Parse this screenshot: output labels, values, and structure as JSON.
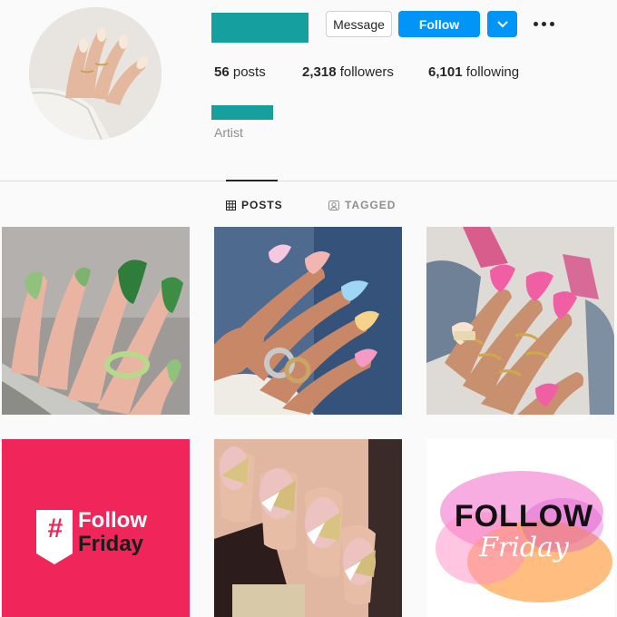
{
  "profile": {
    "bio_category": "Artist",
    "stats": {
      "posts_count": "56",
      "posts_label": "posts",
      "followers_count": "2,318",
      "followers_label": "followers",
      "following_count": "6,101",
      "following_label": "following"
    }
  },
  "actions": {
    "message_label": "Message",
    "follow_label": "Follow",
    "dropdown_icon": "chevron-down-icon",
    "more_icon": "ellipsis-icon"
  },
  "tabs": [
    {
      "label": "POSTS",
      "icon": "grid-icon",
      "active": true
    },
    {
      "label": "TAGGED",
      "icon": "tag-user-icon",
      "active": false
    }
  ],
  "posts": [
    {
      "kind": "photo",
      "subject": "green-french-tip-nails"
    },
    {
      "kind": "photo",
      "subject": "pastel-tip-nails"
    },
    {
      "kind": "photo",
      "subject": "pink-marble-nails"
    },
    {
      "kind": "graphic",
      "line1": "Follow",
      "line2": "Friday",
      "hash": "#",
      "bg_color": "#f0265a"
    },
    {
      "kind": "photo",
      "subject": "pink-gold-geometric-nails"
    },
    {
      "kind": "graphic",
      "line1": "FOLLOW",
      "line2": "Friday",
      "bg_color": "#ffffff"
    }
  ],
  "colors": {
    "accent": "#0095f6",
    "redaction": "#159f9f",
    "text_muted": "#8e8e8e"
  }
}
